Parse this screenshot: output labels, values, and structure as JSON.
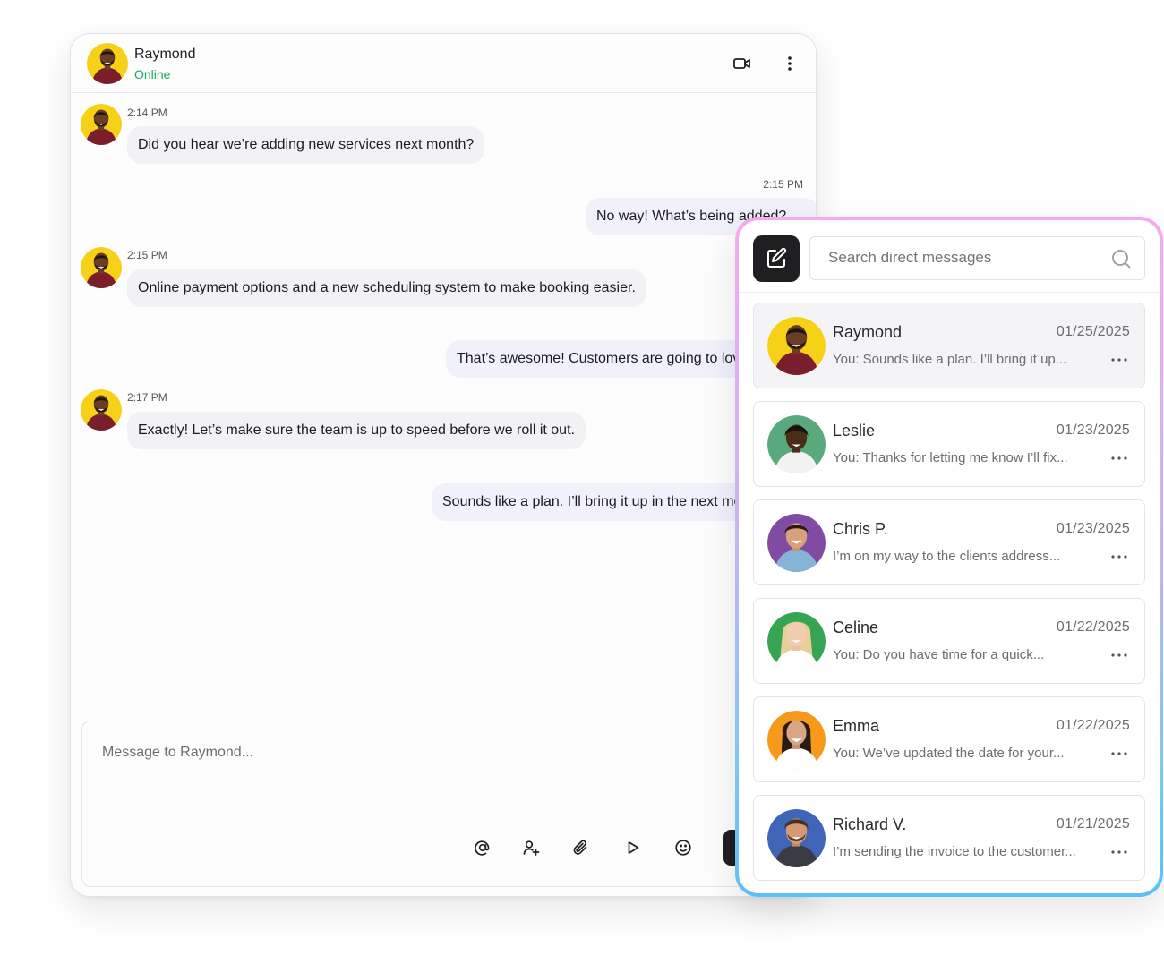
{
  "chat": {
    "contact_name": "Raymond",
    "contact_status": "Online",
    "header_icons": [
      "video-call-icon",
      "more-vertical-icon"
    ],
    "messages": [
      {
        "direction": "in",
        "time": "2:14 PM",
        "text": "Did you hear we’re adding new services next month?"
      },
      {
        "direction": "out",
        "time": "2:15 PM",
        "text": "No way! What’s being added?"
      },
      {
        "direction": "in",
        "time": "2:15 PM",
        "text": "Online payment options and a new scheduling system to make booking easier."
      },
      {
        "direction": "out",
        "time": "",
        "text": "That’s awesome! Customers are going to love it."
      },
      {
        "direction": "in",
        "time": "2:17 PM",
        "text": "Exactly! Let’s make sure the team is up to speed before we roll it out."
      },
      {
        "direction": "out",
        "time": "",
        "text": "Sounds like a plan. I’ll bring it up in the next meeting."
      }
    ],
    "composer": {
      "placeholder": "Message to Raymond...",
      "tools": [
        "mention-icon",
        "add-person-icon",
        "attachment-icon",
        "play-icon",
        "emoji-icon"
      ]
    }
  },
  "dm_panel": {
    "search_placeholder": "Search direct messages",
    "conversations": [
      {
        "name": "Raymond",
        "date": "01/25/2025",
        "preview": "You: Sounds like a plan. I’ll bring it up...",
        "avatar_bg": "#f7d117",
        "active": true
      },
      {
        "name": "Leslie",
        "date": "01/23/2025",
        "preview": "You: Thanks for letting me know I’ll fix...",
        "avatar_bg": "#5aa97d",
        "active": false
      },
      {
        "name": "Chris P.",
        "date": "01/23/2025",
        "preview": "I’m on my way to the clients address...",
        "avatar_bg": "#7f4ba3",
        "active": false
      },
      {
        "name": "Celine",
        "date": "01/22/2025",
        "preview": "You: Do you have time for a quick...",
        "avatar_bg": "#35a553",
        "active": false
      },
      {
        "name": "Emma",
        "date": "01/22/2025",
        "preview": "You: We’ve updated the date for your...",
        "avatar_bg": "#f79a1c",
        "active": false
      },
      {
        "name": "Richard V.",
        "date": "01/21/2025",
        "preview": "I’m sending the invoice to the customer...",
        "avatar_bg": "#3f64b8",
        "active": false
      }
    ]
  },
  "colors": {
    "online": "#1aa562",
    "panel_gradient_top": "#f6a9f1",
    "panel_gradient_bottom": "#5bc0f8",
    "button_dark": "#1f1f22"
  }
}
